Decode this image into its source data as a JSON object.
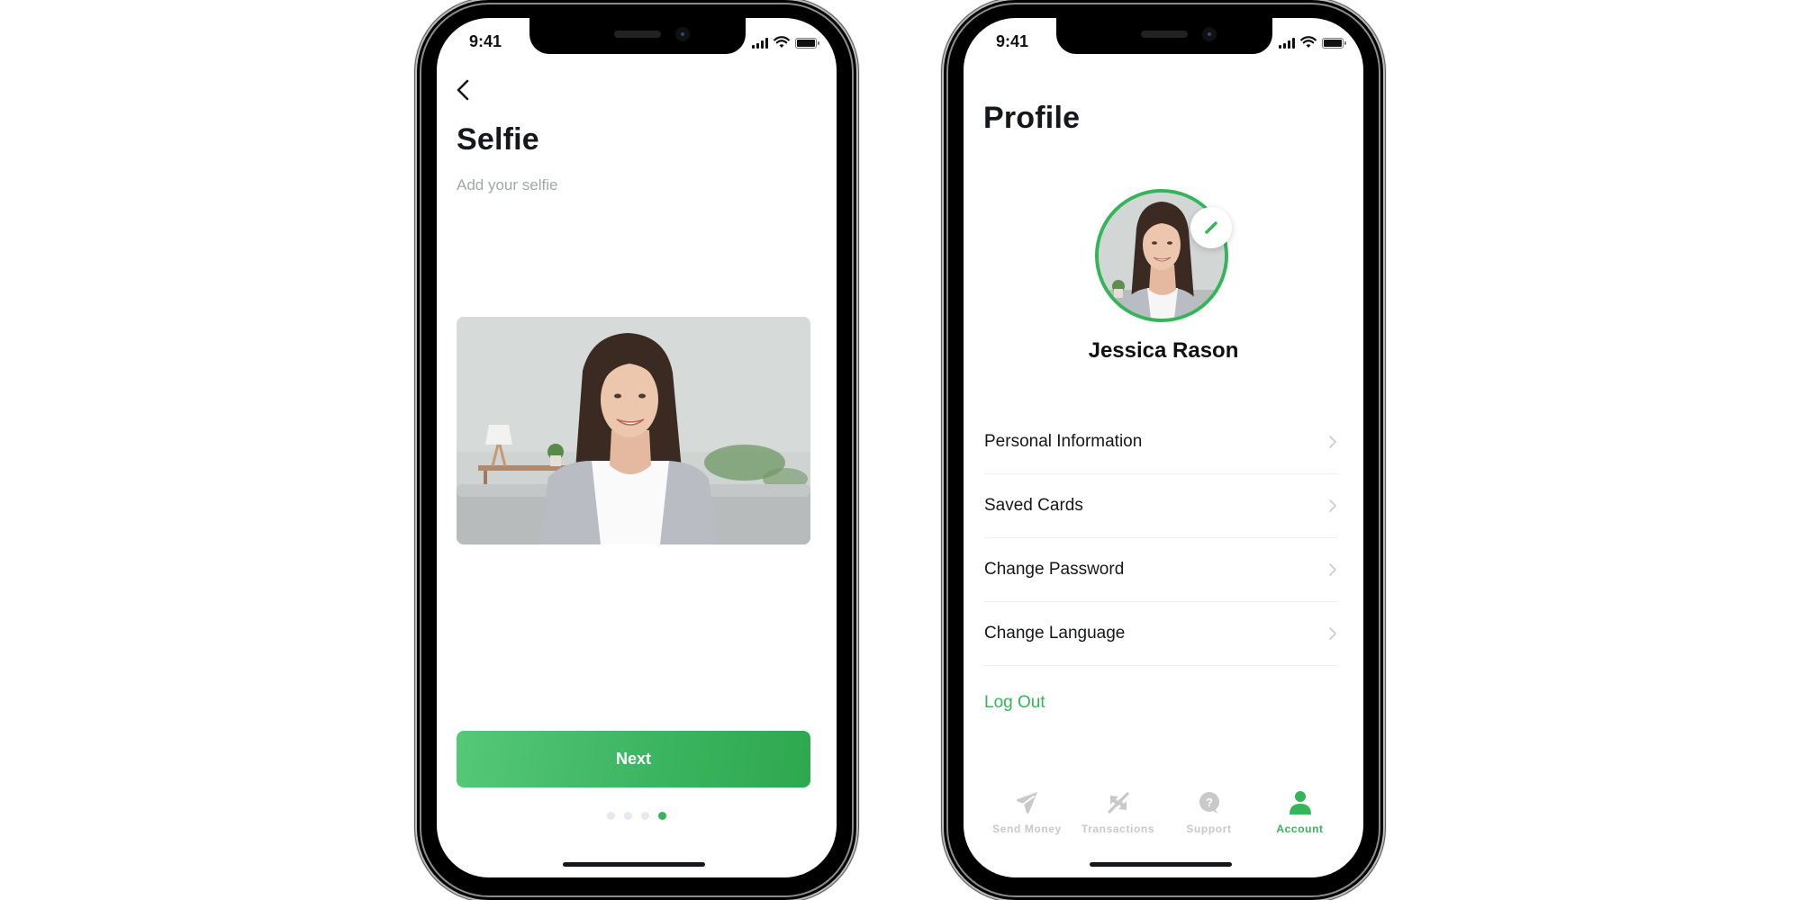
{
  "theme": {
    "accent": "#35b55a",
    "text_primary": "#15171c",
    "text_muted": "#a2a6ae",
    "tab_inactive": "#c9c9c9",
    "dot_inactive": "#e5e9f0"
  },
  "left_phone": {
    "status_bar": {
      "time": "9:41",
      "icons": [
        "signal-icon",
        "wifi-icon",
        "battery-icon"
      ]
    },
    "back_icon": "chevron-left-icon",
    "title": "Selfie",
    "subtitle": "Add your selfie",
    "photo": {
      "description": "Selfie photo of a smiling woman with long brown hair seated on a grey sofa"
    },
    "next_button": "Next",
    "pagination": {
      "total": 4,
      "current": 4
    }
  },
  "right_phone": {
    "status_bar": {
      "time": "9:41",
      "icons": [
        "signal-icon",
        "wifi-icon",
        "battery-icon"
      ]
    },
    "title": "Profile",
    "avatar": {
      "description": "Profile photo of a smiling woman",
      "edit_icon": "pencil-icon"
    },
    "name": "Jessica Rason",
    "menu": [
      {
        "label": "Personal Information",
        "icon": "chevron-right-icon"
      },
      {
        "label": "Saved Cards",
        "icon": "chevron-right-icon"
      },
      {
        "label": "Change Password",
        "icon": "chevron-right-icon"
      },
      {
        "label": "Change Language",
        "icon": "chevron-right-icon"
      }
    ],
    "logout": "Log Out",
    "tabs": [
      {
        "label": "Send Money",
        "icon": "send-icon",
        "active": false
      },
      {
        "label": "Transactions",
        "icon": "transactions-icon",
        "active": false
      },
      {
        "label": "Support",
        "icon": "support-icon",
        "active": false
      },
      {
        "label": "Account",
        "icon": "user-icon",
        "active": true
      }
    ]
  }
}
